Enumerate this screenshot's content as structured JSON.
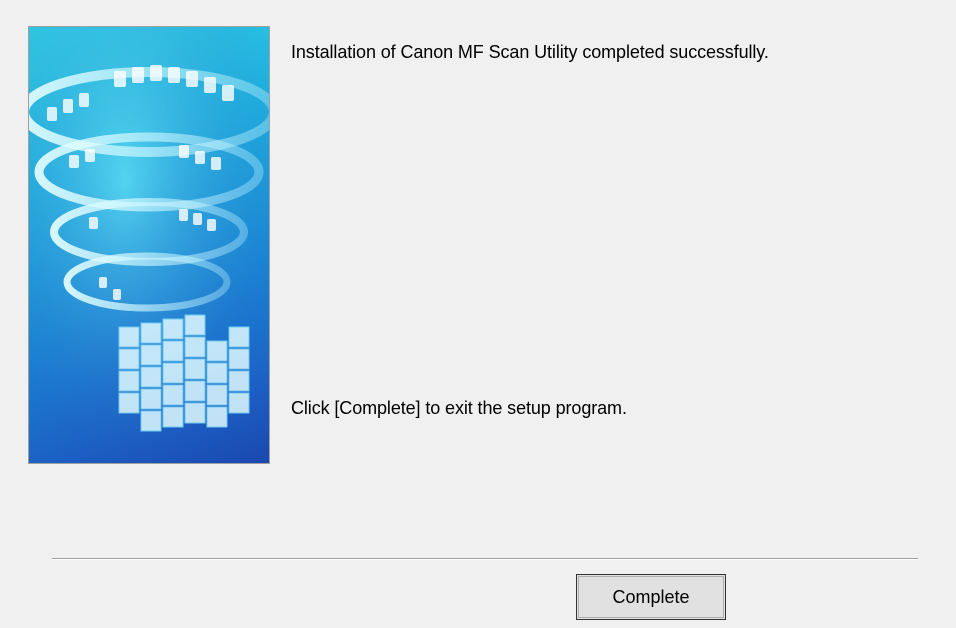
{
  "dialog": {
    "message_top": "Installation of Canon MF Scan Utility completed successfully.",
    "message_bottom": "Click [Complete] to exit the setup program.",
    "complete_button": "Complete"
  },
  "colors": {
    "background": "#f0f0f0",
    "banner_light": "#2fd3e6",
    "banner_dark": "#1a48b0",
    "button_face": "#e1e1e1"
  },
  "icons": {
    "banner": "canon-setup-banner-image"
  }
}
